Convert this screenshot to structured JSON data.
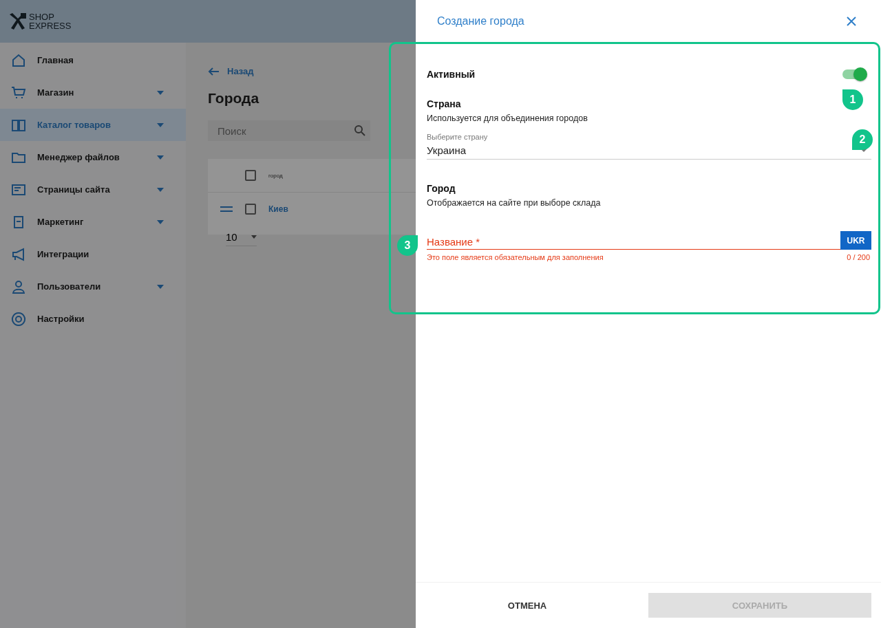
{
  "logo": {
    "line1": "SHOP",
    "line2": "EXPRESS"
  },
  "sidebar": {
    "items": [
      {
        "label": "Главная",
        "kind": "home",
        "expandable": false,
        "selected": false
      },
      {
        "label": "Магазин",
        "kind": "cart",
        "expandable": true,
        "selected": false
      },
      {
        "label": "Каталог товаров",
        "kind": "book",
        "expandable": true,
        "selected": true
      },
      {
        "label": "Менеджер файлов",
        "kind": "folder",
        "expandable": true,
        "selected": false
      },
      {
        "label": "Страницы сайта",
        "kind": "page",
        "expandable": true,
        "selected": false
      },
      {
        "label": "Маркетинг",
        "kind": "bag",
        "expandable": true,
        "selected": false
      },
      {
        "label": "Интеграции",
        "kind": "megaphone",
        "expandable": false,
        "selected": false
      },
      {
        "label": "Пользователи",
        "kind": "user",
        "expandable": true,
        "selected": false
      },
      {
        "label": "Настройки",
        "kind": "gear",
        "expandable": false,
        "selected": false
      }
    ]
  },
  "page": {
    "back": "Назад",
    "title": "Города",
    "search": {
      "placeholder": "Поиск"
    },
    "table": {
      "columns": [
        "город"
      ],
      "rows": [
        {
          "city": "Киев",
          "checked": false
        }
      ],
      "header_checked": false,
      "page_size": "10"
    }
  },
  "drawer": {
    "title": "Создание города",
    "active": {
      "label": "Активный",
      "on": true
    },
    "country": {
      "heading": "Страна",
      "hint": "Используется для объединения городов",
      "field_label": "Выберите страну",
      "value": "Украина"
    },
    "city": {
      "heading": "Город",
      "hint": "Отображается на сайте при выборе склада",
      "placeholder": "Название *",
      "lang": "UKR",
      "error": "Это поле является обязательным для заполнения",
      "counter": "0 / 200"
    },
    "buttons": [
      {
        "label": "ОТМЕНА",
        "disabled": false
      },
      {
        "label": "СОХРАНИТЬ",
        "disabled": true
      }
    ]
  },
  "annotations": [
    "1",
    "2",
    "3"
  ]
}
